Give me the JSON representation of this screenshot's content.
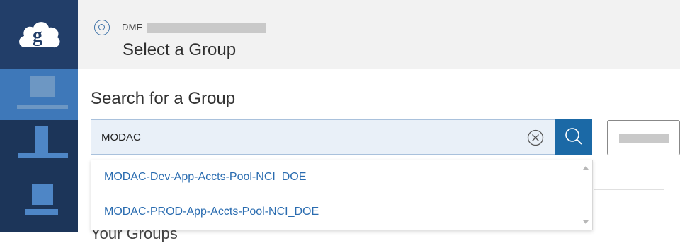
{
  "header": {
    "org_label": "DME",
    "title": "Select a Group"
  },
  "search": {
    "heading": "Search for a Group",
    "value": "MODAC",
    "placeholder": ""
  },
  "dropdown": {
    "items": [
      "MODAC-Dev-App-Accts-Pool-NCI_DOE",
      "MODAC-PROD-App-Accts-Pool-NCI_DOE"
    ]
  },
  "section": {
    "your_groups": "Your Groups"
  },
  "icons": {
    "logo": "globus-logo-icon",
    "org": "circle-target-icon",
    "clear": "clear-x-icon",
    "search": "search-icon"
  },
  "colors": {
    "sidebar_bg": "#1c3559",
    "sidebar_active": "#3e78b9",
    "search_button": "#1b69a6",
    "link_text": "#2a6cb0"
  }
}
